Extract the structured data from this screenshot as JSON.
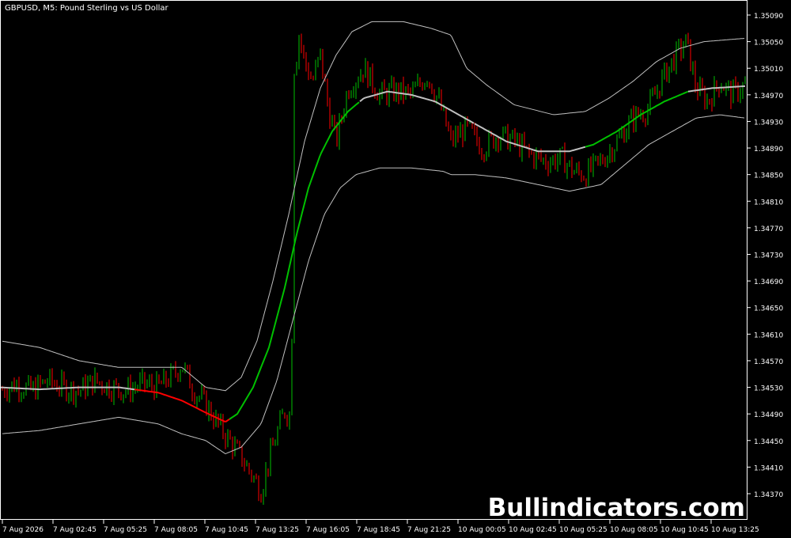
{
  "chart_data": {
    "type": "line",
    "title": "GBPUSD, M5:  Pound Sterling vs US Dollar",
    "watermark": "Bullindicators.com",
    "series": [],
    "y_ticks": [
      "1.35090",
      "1.35050",
      "1.35010",
      "1.34970",
      "1.34930",
      "1.34890",
      "1.34850",
      "1.34810",
      "1.34770",
      "1.34730",
      "1.34690",
      "1.34650",
      "1.34610",
      "1.34570",
      "1.34530",
      "1.34490",
      "1.34450",
      "1.34410",
      "1.34370"
    ],
    "x_ticks": [
      "7 Aug 2026",
      "7 Aug 02:45",
      "7 Aug 05:25",
      "7 Aug 08:05",
      "7 Aug 10:45",
      "7 Aug 13:25",
      "7 Aug 16:05",
      "7 Aug 18:45",
      "7 Aug 21:25",
      "10 Aug 00:05",
      "10 Aug 02:45",
      "10 Aug 05:25",
      "10 Aug 08:05",
      "10 Aug 10:45",
      "10 Aug 13:25"
    ],
    "ylim": [
      1.34345,
      1.35105
    ],
    "grid": false,
    "colors": {
      "background": "#000000",
      "text": "#ffffff",
      "bull": "#00c000",
      "bear": "#ff0000",
      "midline_flat": "#c0c0c0",
      "band": "#c0c0c0"
    },
    "price_path": [
      [
        0,
        1.34525
      ],
      [
        20,
        1.34535
      ],
      [
        40,
        1.34525
      ],
      [
        60,
        1.3454
      ],
      [
        80,
        1.3453
      ],
      [
        100,
        1.34525
      ],
      [
        120,
        1.3454
      ],
      [
        140,
        1.3453
      ],
      [
        160,
        1.34525
      ],
      [
        180,
        1.34535
      ],
      [
        200,
        1.3453
      ],
      [
        220,
        1.3455
      ],
      [
        230,
        1.34565
      ],
      [
        245,
        1.34525
      ],
      [
        260,
        1.34505
      ],
      [
        275,
        1.34475
      ],
      [
        290,
        1.3445
      ],
      [
        305,
        1.34425
      ],
      [
        320,
        1.34395
      ],
      [
        330,
        1.34375
      ],
      [
        340,
        1.3442
      ],
      [
        350,
        1.3446
      ],
      [
        360,
        1.34495
      ],
      [
        368,
        1.34485
      ],
      [
        372,
        1.35
      ],
      [
        378,
        1.3506
      ],
      [
        385,
        1.3502
      ],
      [
        395,
        1.3499
      ],
      [
        405,
        1.3503
      ],
      [
        415,
        1.3495
      ],
      [
        425,
        1.349
      ],
      [
        440,
        1.3498
      ],
      [
        460,
        1.3501
      ],
      [
        480,
        1.3497
      ],
      [
        500,
        1.34975
      ],
      [
        520,
        1.3497
      ],
      [
        540,
        1.35
      ],
      [
        555,
        1.3496
      ],
      [
        570,
        1.349
      ],
      [
        590,
        1.3492
      ],
      [
        610,
        1.3489
      ],
      [
        630,
        1.3491
      ],
      [
        650,
        1.349
      ],
      [
        670,
        1.3488
      ],
      [
        690,
        1.3487
      ],
      [
        710,
        1.34875
      ],
      [
        725,
        1.34855
      ],
      [
        740,
        1.3485
      ],
      [
        760,
        1.3487
      ],
      [
        780,
        1.349
      ],
      [
        800,
        1.34935
      ],
      [
        820,
        1.3495
      ],
      [
        840,
        1.35
      ],
      [
        855,
        1.3503
      ],
      [
        868,
        1.3505
      ],
      [
        880,
        1.3498
      ],
      [
        895,
        1.3496
      ],
      [
        910,
        1.3499
      ],
      [
        925,
        1.3497
      ],
      [
        942,
        1.34985
      ]
    ],
    "midline": [
      [
        0,
        1.3453
      ],
      [
        50,
        1.34527
      ],
      [
        100,
        1.3453
      ],
      [
        150,
        1.3453
      ],
      [
        200,
        1.34522
      ],
      [
        230,
        1.3451
      ],
      [
        260,
        1.34492
      ],
      [
        285,
        1.34478
      ],
      [
        300,
        1.3449
      ],
      [
        320,
        1.3453
      ],
      [
        340,
        1.3459
      ],
      [
        360,
        1.3468
      ],
      [
        375,
        1.3476
      ],
      [
        390,
        1.3483
      ],
      [
        405,
        1.3488
      ],
      [
        420,
        1.34915
      ],
      [
        440,
        1.34945
      ],
      [
        460,
        1.34965
      ],
      [
        490,
        1.34975
      ],
      [
        520,
        1.3497
      ],
      [
        550,
        1.3496
      ],
      [
        580,
        1.3494
      ],
      [
        610,
        1.3492
      ],
      [
        640,
        1.349
      ],
      [
        680,
        1.34885
      ],
      [
        720,
        1.34885
      ],
      [
        750,
        1.34895
      ],
      [
        780,
        1.34915
      ],
      [
        810,
        1.3494
      ],
      [
        840,
        1.3496
      ],
      [
        870,
        1.34975
      ],
      [
        900,
        1.3498
      ],
      [
        942,
        1.34983
      ]
    ],
    "midline_segments": [
      {
        "from": 0,
        "to": 170,
        "color": "midline_flat"
      },
      {
        "from": 170,
        "to": 290,
        "color": "bear"
      },
      {
        "from": 290,
        "to": 455,
        "color": "bull"
      },
      {
        "from": 455,
        "to": 600,
        "color": "midline_flat"
      },
      {
        "from": 600,
        "to": 740,
        "color": "midline_flat"
      },
      {
        "from": 740,
        "to": 870,
        "color": "bull"
      },
      {
        "from": 870,
        "to": 942,
        "color": "midline_flat"
      }
    ],
    "upper_band": [
      [
        0,
        1.346
      ],
      [
        50,
        1.3459
      ],
      [
        100,
        1.3457
      ],
      [
        150,
        1.3456
      ],
      [
        200,
        1.3456
      ],
      [
        230,
        1.3456
      ],
      [
        260,
        1.3453
      ],
      [
        285,
        1.34525
      ],
      [
        305,
        1.34545
      ],
      [
        325,
        1.346
      ],
      [
        345,
        1.3469
      ],
      [
        365,
        1.3479
      ],
      [
        385,
        1.349
      ],
      [
        405,
        1.3498
      ],
      [
        425,
        1.3503
      ],
      [
        445,
        1.35065
      ],
      [
        470,
        1.3508
      ],
      [
        510,
        1.3508
      ],
      [
        545,
        1.3507
      ],
      [
        570,
        1.3506
      ],
      [
        590,
        1.3501
      ],
      [
        615,
        1.34985
      ],
      [
        650,
        1.34955
      ],
      [
        700,
        1.3494
      ],
      [
        740,
        1.34945
      ],
      [
        770,
        1.34965
      ],
      [
        800,
        1.3499
      ],
      [
        830,
        1.3502
      ],
      [
        860,
        1.3504
      ],
      [
        890,
        1.3505
      ],
      [
        942,
        1.35055
      ]
    ],
    "lower_band": [
      [
        0,
        1.3446
      ],
      [
        50,
        1.34465
      ],
      [
        100,
        1.34475
      ],
      [
        150,
        1.34485
      ],
      [
        200,
        1.34475
      ],
      [
        230,
        1.3446
      ],
      [
        260,
        1.3445
      ],
      [
        285,
        1.3443
      ],
      [
        305,
        1.3444
      ],
      [
        330,
        1.34475
      ],
      [
        350,
        1.3454
      ],
      [
        370,
        1.3463
      ],
      [
        390,
        1.3472
      ],
      [
        410,
        1.3479
      ],
      [
        430,
        1.3483
      ],
      [
        450,
        1.3485
      ],
      [
        480,
        1.3486
      ],
      [
        520,
        1.3486
      ],
      [
        560,
        1.34855
      ],
      [
        570,
        1.3485
      ],
      [
        600,
        1.3485
      ],
      [
        640,
        1.34845
      ],
      [
        680,
        1.34835
      ],
      [
        720,
        1.34825
      ],
      [
        760,
        1.34835
      ],
      [
        790,
        1.34865
      ],
      [
        820,
        1.34895
      ],
      [
        850,
        1.34915
      ],
      [
        880,
        1.34935
      ],
      [
        910,
        1.3494
      ],
      [
        942,
        1.34935
      ]
    ]
  }
}
